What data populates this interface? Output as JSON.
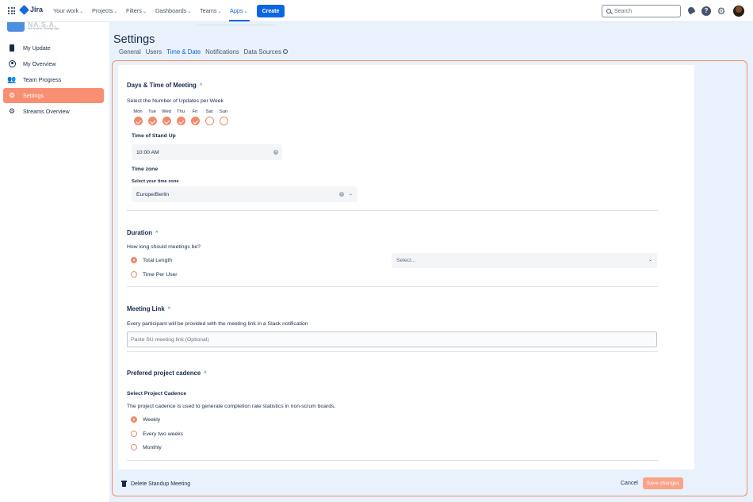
{
  "topnav": {
    "brand": "Jira",
    "items": [
      {
        "label": "Your work"
      },
      {
        "label": "Projects"
      },
      {
        "label": "Filters"
      },
      {
        "label": "Dashboards"
      },
      {
        "label": "Teams"
      },
      {
        "label": "Apps"
      }
    ],
    "active_item": "Apps",
    "create_label": "Create",
    "search_placeholder": "Search",
    "icons": [
      "app-switcher-icon",
      "jira-logo-icon",
      "notifications-icon",
      "help-icon",
      "settings-icon",
      "avatar"
    ]
  },
  "sidebar": {
    "app_name": "NA.S.A.",
    "app_tagline": "Not Another Standup App",
    "items": [
      {
        "label": "My Update",
        "icon": "phone-icon"
      },
      {
        "label": "My Overview",
        "icon": "user-circle-icon"
      },
      {
        "label": "Team Progress",
        "icon": "team-icon"
      },
      {
        "label": "Settings",
        "icon": "gear-icon",
        "active": true
      },
      {
        "label": "Streams Overview",
        "icon": "gear-icon"
      }
    ]
  },
  "page": {
    "title": "Settings",
    "tabs": [
      {
        "label": "General"
      },
      {
        "label": "Users"
      },
      {
        "label": "Time & Date",
        "active": true
      },
      {
        "label": "Notifications"
      },
      {
        "label": "Data Sources"
      }
    ]
  },
  "days_section": {
    "title": "Days & Time of Meeting",
    "subtitle": "Select the Number of Updates per Week",
    "days": [
      {
        "label": "Mon",
        "checked": true
      },
      {
        "label": "Tue",
        "checked": true
      },
      {
        "label": "Wed",
        "checked": true
      },
      {
        "label": "Thu",
        "checked": true
      },
      {
        "label": "Fri",
        "checked": true
      },
      {
        "label": "Sat",
        "checked": false
      },
      {
        "label": "Sun",
        "checked": false
      }
    ],
    "standup_label": "Time of Stand Up",
    "standup_value": "10:00 AM",
    "timezone_label": "Time zone",
    "timezone_field_label": "Select your time zone",
    "timezone_value": "Europe/Berlin"
  },
  "duration_section": {
    "title": "Duration",
    "question": "How long should meetings be?",
    "options": [
      {
        "label": "Total Length",
        "selected": true
      },
      {
        "label": "Time Per User",
        "selected": false
      }
    ],
    "select_placeholder": "Select..."
  },
  "link_section": {
    "title": "Meeting Link",
    "description": "Every participant will be provided with the meeting link in a Slack notification",
    "placeholder": "Paste SU meeting link (Optional)"
  },
  "cadence_section": {
    "title": "Prefered project cadence",
    "subtitle": "Select Project Cadence",
    "description": "The project cadence is used to generate completion rate statistics in non-scrum boards.",
    "options": [
      {
        "label": "Weekly",
        "selected": true
      },
      {
        "label": "Every two weeks",
        "selected": false
      },
      {
        "label": "Monthly",
        "selected": false
      }
    ]
  },
  "footer": {
    "delete_label": "Delete Standup Meeting",
    "cancel_label": "Cancel",
    "save_label": "Save changes"
  },
  "colors": {
    "accent": "#f08a6a",
    "primary_blue": "#0c66e4",
    "frame_border": "#ee8d61",
    "background": "#e9f2fc"
  }
}
